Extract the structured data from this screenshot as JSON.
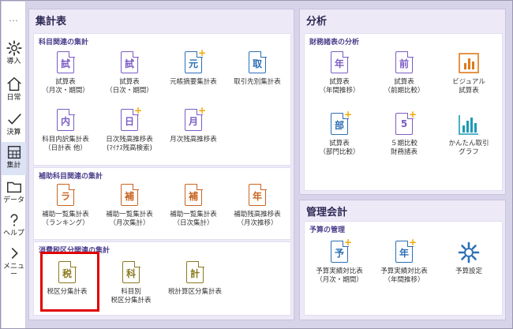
{
  "colors": {
    "purple": "#7b5cc4",
    "blue": "#2c6fb5",
    "orange": "#c9641f",
    "olive": "#8a7a1e",
    "accent": "#f2a900",
    "highlight": "#e00000"
  },
  "sidebar": {
    "more": "…",
    "items": [
      {
        "label": "導入",
        "icon": "gear-icon"
      },
      {
        "label": "日常",
        "icon": "home-icon"
      },
      {
        "label": "決算",
        "icon": "check-icon"
      },
      {
        "label": "集計",
        "icon": "calculator-icon"
      },
      {
        "label": "データ",
        "icon": "folder-icon"
      },
      {
        "label": "ヘルプ",
        "icon": "help-icon"
      },
      {
        "label": "メニュー",
        "icon": "chevron-right-icon"
      }
    ]
  },
  "shukei": {
    "title": "集計表",
    "sections": [
      {
        "title": "科目関連の集計",
        "tiles": [
          {
            "ch": "試",
            "label": "試算表\n（月次・期間）",
            "plus": false
          },
          {
            "ch": "試",
            "label": "試算表\n（日次・期間）",
            "plus": false
          },
          {
            "ch": "元",
            "label": "元帳摘要集計表",
            "plus": true
          },
          {
            "ch": "取",
            "label": "取引先別集計表",
            "plus": false
          },
          {
            "ch": "内",
            "label": "科目内訳集計表\n（日計表 他）",
            "plus": false
          },
          {
            "ch": "日",
            "label": "日次残高推移表\n(ﾏｲﾅｽ残高検索)",
            "plus": true
          },
          {
            "ch": "月",
            "label": "月次残高推移表",
            "plus": true
          }
        ]
      },
      {
        "title": "補助科目関連の集計",
        "tiles": [
          {
            "ch": "ラ",
            "label": "補助一覧集計表\n（ランキング）",
            "plus": false
          },
          {
            "ch": "補",
            "label": "補助一覧集計表\n（月次集計）",
            "plus": false
          },
          {
            "ch": "補",
            "label": "補助一覧集計表\n（日次集計）",
            "plus": false
          },
          {
            "ch": "年",
            "label": "補助残高推移表\n（月次推移）",
            "plus": false
          }
        ]
      },
      {
        "title": "消費税区分関連の集計",
        "tiles": [
          {
            "ch": "税",
            "label": "税区分集計表",
            "plus": false
          },
          {
            "ch": "科",
            "label": "科目別\n税区分集計表",
            "plus": false
          },
          {
            "ch": "計",
            "label": "税計算区分集計表",
            "plus": false
          }
        ]
      }
    ]
  },
  "bunseki": {
    "title": "分析",
    "section_title": "財務諸表の分析",
    "tiles": [
      {
        "ch": "年",
        "label": "試算表\n（年間推移）",
        "plus": false
      },
      {
        "ch": "前",
        "label": "試算表\n（前期比較）",
        "plus": false
      },
      {
        "ch": "",
        "label": "ビジュアル\n試算表",
        "plus": false,
        "icon": "bar-chart-icon"
      },
      {
        "ch": "部",
        "label": "試算表\n（部門比較）",
        "plus": true
      },
      {
        "ch": "5",
        "label": "５期比較\n財務諸表",
        "plus": true
      },
      {
        "ch": "",
        "label": "かんたん取引\nグラフ",
        "plus": false,
        "icon": "bar-graph-icon"
      }
    ]
  },
  "kanri": {
    "title": "管理会計",
    "section_title": "予算の管理",
    "tiles": [
      {
        "ch": "予",
        "label": "予算実績対比表\n（月次・期間）",
        "plus": true
      },
      {
        "ch": "年",
        "label": "予算実績対比表\n（年間推移）",
        "plus": true
      },
      {
        "ch": "",
        "label": "予算設定",
        "plus": false,
        "icon": "gear-icon"
      }
    ]
  }
}
